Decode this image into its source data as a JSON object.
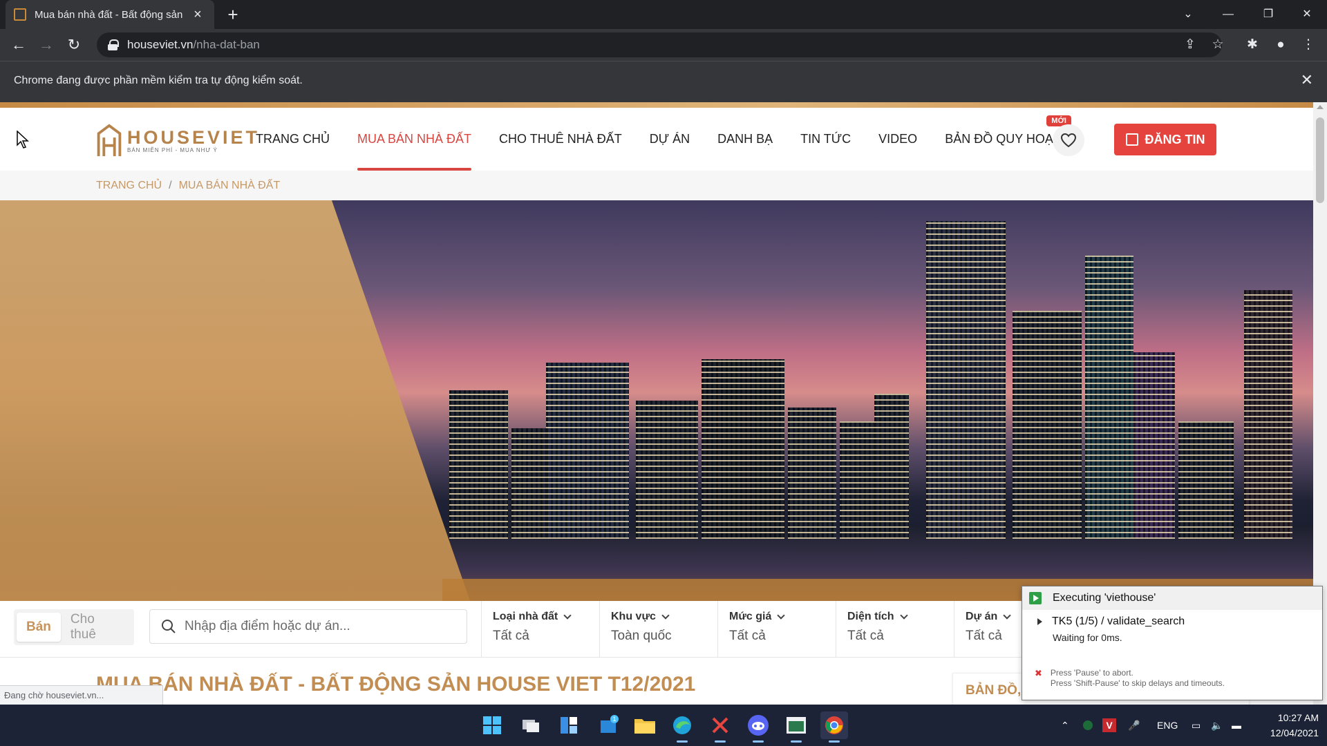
{
  "browser": {
    "tab_title": "Mua bán nhà đất - Bất động sản",
    "url_host": "houseviet.vn",
    "url_path": "/nha-dat-ban",
    "automation_notice": "Chrome đang được phần mềm kiểm tra tự động kiểm soát."
  },
  "site": {
    "logo_name": "HOUSEVIET",
    "logo_tagline": "BÁN MIỄN PHÍ - MUA NHƯ Ý",
    "menu": [
      {
        "label": "TRANG CHỦ"
      },
      {
        "label": "MUA BÁN NHÀ ĐẤT"
      },
      {
        "label": "CHO THUÊ NHÀ ĐẤT"
      },
      {
        "label": "DỰ ÁN"
      },
      {
        "label": "DANH BẠ"
      },
      {
        "label": "TIN TỨC"
      },
      {
        "label": "VIDEO"
      },
      {
        "label": "BẢN ĐỒ QUY HOẠCH"
      }
    ],
    "new_badge": "MỚI",
    "post_button": "ĐĂNG TIN",
    "accent_color": "#e4443d",
    "brand_color": "#c18d52"
  },
  "breadcrumb": {
    "home": "TRANG CHỦ",
    "separator": "/",
    "current": "MUA BÁN NHÀ ĐẤT"
  },
  "search": {
    "type_sell": "Bán",
    "type_rent": "Cho thuê",
    "placeholder": "Nhập địa điểm hoặc dự án...",
    "filters": [
      {
        "label": "Loại nhà đất",
        "value": "Tất cả"
      },
      {
        "label": "Khu vực",
        "value": "Toàn quốc"
      },
      {
        "label": "Mức giá",
        "value": "Tất cả"
      },
      {
        "label": "Diện tích",
        "value": "Tất cả"
      },
      {
        "label": "Dự án",
        "value": "Tất cả"
      }
    ]
  },
  "content": {
    "heading": "MUA BÁN NHÀ ĐẤT - BẤT ĐỘNG SẢN HOUSE VIET T12/2021",
    "map_card": "BẢN ĐỒ,"
  },
  "status_bubble": "Đang chờ houseviet.vn...",
  "automation": {
    "title": "Executing 'viethouse'",
    "step": "TK5 (1/5) / validate_search",
    "waiting": "Waiting for 0ms.",
    "hint1": "Press 'Pause' to abort.",
    "hint2": "Press 'Shift-Pause' to skip delays and timeouts."
  },
  "taskbar": {
    "language": "ENG",
    "time": "10:27 AM",
    "date": "12/04/2021",
    "store_badge": "1"
  }
}
